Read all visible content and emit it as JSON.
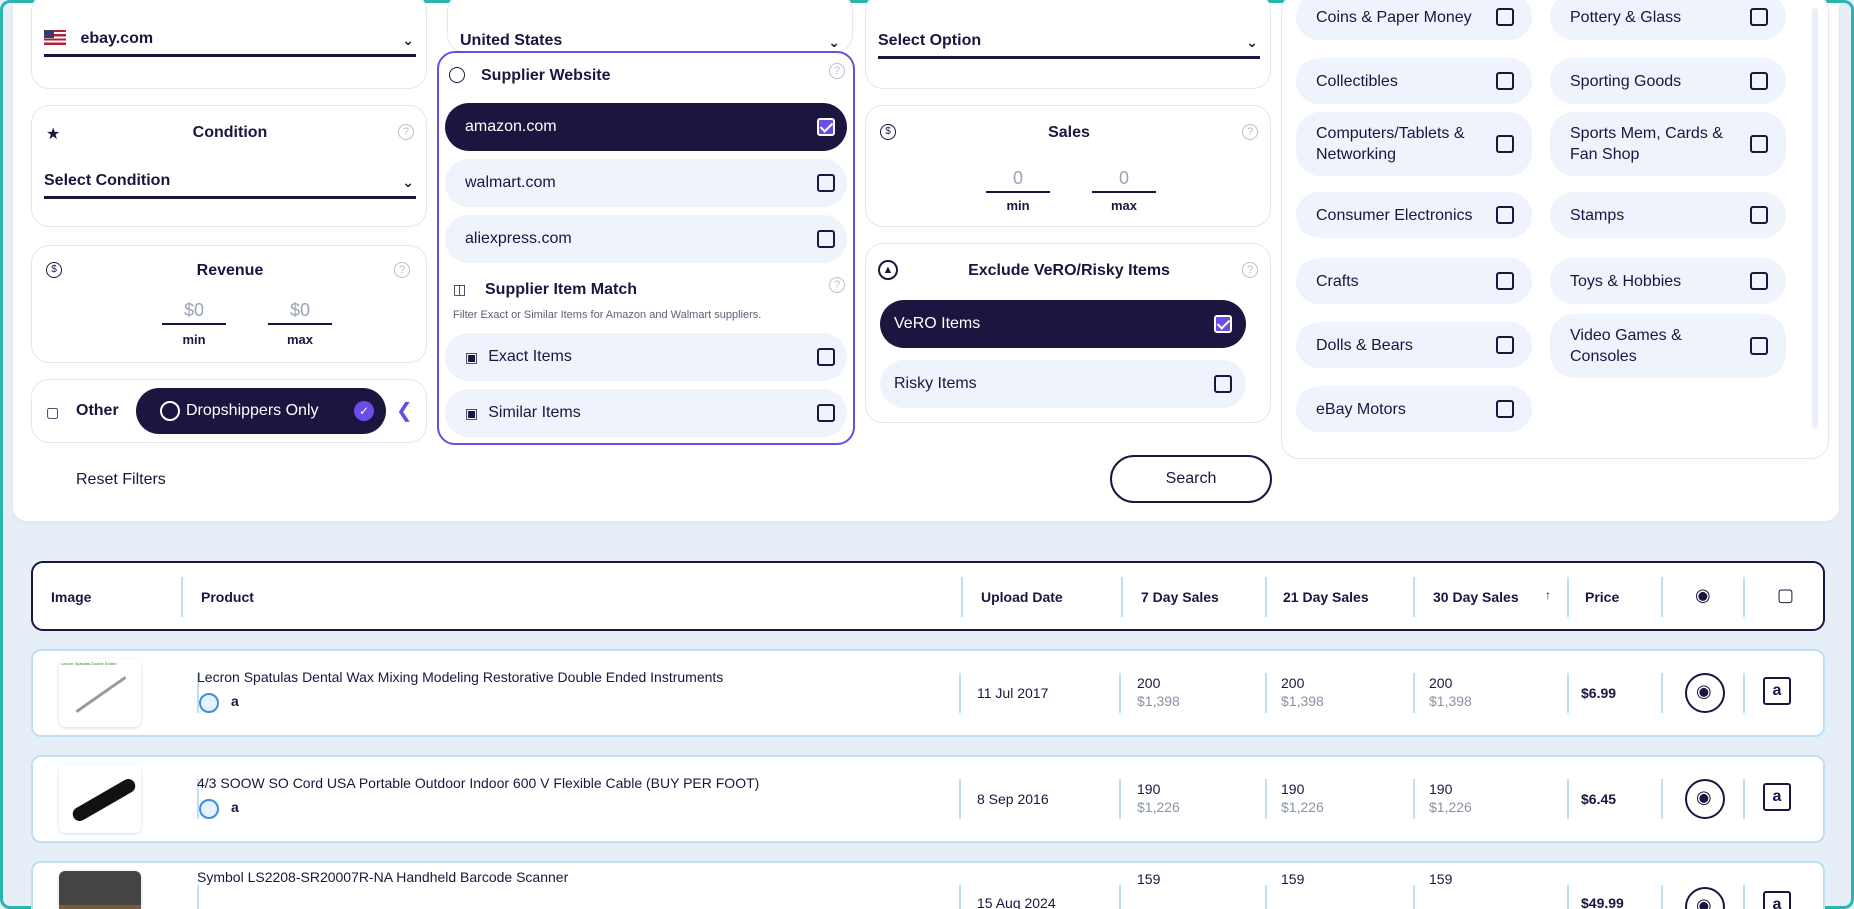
{
  "filters": {
    "marketplace": {
      "value": "ebay.com"
    },
    "condition": {
      "title": "Condition",
      "value": "Select Condition"
    },
    "revenue": {
      "title": "Revenue",
      "min_value": "$0",
      "max_value": "$0",
      "min_label": "min",
      "max_label": "max"
    },
    "other": {
      "label": "Other",
      "dropshippers": "Dropshippers Only"
    },
    "country": {
      "value": "United States"
    },
    "supplier_website": {
      "title": "Supplier Website",
      "options": [
        {
          "label": "amazon.com",
          "checked": true
        },
        {
          "label": "walmart.com",
          "checked": false
        },
        {
          "label": "aliexpress.com",
          "checked": false
        }
      ]
    },
    "supplier_item_match": {
      "title": "Supplier Item Match",
      "description": "Filter Exact or Similar Items for Amazon and Walmart suppliers.",
      "options": [
        {
          "label": "Exact Items",
          "checked": false
        },
        {
          "label": "Similar Items",
          "checked": false
        }
      ]
    },
    "option_select": {
      "value": "Select Option"
    },
    "sales": {
      "title": "Sales",
      "min_value": "0",
      "max_value": "0",
      "min_label": "min",
      "max_label": "max"
    },
    "exclude": {
      "title": "Exclude VeRO/Risky Items",
      "options": [
        {
          "label": "VeRO Items",
          "checked": true
        },
        {
          "label": "Risky Items",
          "checked": false
        }
      ]
    },
    "categories_left": [
      "Coins & Paper Money",
      "Collectibles",
      "Computers/Tablets & Networking",
      "Consumer Electronics",
      "Crafts",
      "Dolls & Bears",
      "eBay Motors"
    ],
    "categories_right": [
      "Pottery & Glass",
      "Sporting Goods",
      "Sports Mem, Cards & Fan Shop",
      "Stamps",
      "Toys & Hobbies",
      "Video Games & Consoles"
    ],
    "reset_label": "Reset Filters",
    "search_label": "Search"
  },
  "table": {
    "headers": {
      "image": "Image",
      "product": "Product",
      "upload_date": "Upload Date",
      "sales7": "7 Day Sales",
      "sales21": "21 Day Sales",
      "sales30": "30 Day Sales",
      "price": "Price"
    },
    "rows": [
      {
        "title": "Lecron Spatulas Dental Wax Mixing Modeling Restorative Double Ended Instruments",
        "thumb_caption": "Lecron Spatulas Double Ended",
        "date": "11 Jul 2017",
        "s7": "200",
        "r7": "$1,398",
        "s21": "200",
        "r21": "$1,398",
        "s30": "200",
        "r30": "$1,398",
        "price": "$6.99"
      },
      {
        "title": "4/3 SOOW SO Cord USA Portable Outdoor Indoor 600 V Flexible Cable (BUY PER FOOT)",
        "date": "8 Sep 2016",
        "s7": "190",
        "r7": "$1,226",
        "s21": "190",
        "r21": "$1,226",
        "s30": "190",
        "r30": "$1,226",
        "price": "$6.45"
      },
      {
        "title": "Symbol LS2208-SR20007R-NA Handheld Barcode Scanner",
        "date": "15 Aug 2024",
        "s7": "159",
        "r7": "",
        "s21": "159",
        "r21": "",
        "s30": "159",
        "r30": "",
        "price": "$49.99"
      }
    ]
  },
  "colors": {
    "navy": "#1b1640",
    "accent": "#6b4de6",
    "pill": "#eef3fc",
    "frame": "#2bb5b0"
  }
}
